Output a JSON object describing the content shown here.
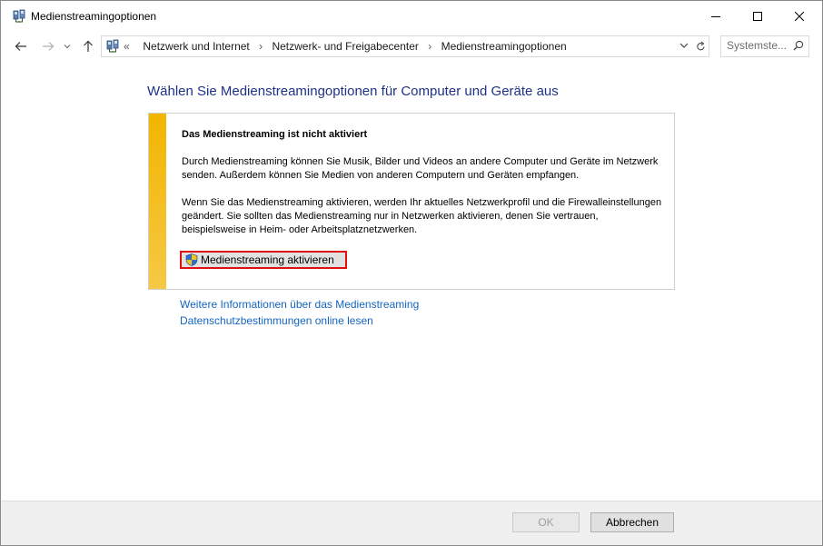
{
  "window": {
    "title": "Medienstreamingoptionen",
    "icon": "network-control-panel-icon",
    "controls": [
      "minimize-icon",
      "maximize-icon",
      "close-icon"
    ]
  },
  "address_bar": {
    "overflow": "«",
    "breadcrumbs": [
      "Netzwerk und Internet",
      "Netzwerk- und Freigabecenter",
      "Medienstreamingoptionen"
    ],
    "search_placeholder": "Systemste..."
  },
  "main": {
    "heading": "Wählen Sie Medienstreamingoptionen für Computer und Geräte aus",
    "notice": {
      "accent_color": "#f2b500",
      "title": "Das Medienstreaming ist nicht aktiviert",
      "paragraph1": "Durch Medienstreaming können Sie Musik, Bilder und Videos an andere Computer und Geräte im Netzwerk senden. Außerdem können Sie Medien von anderen Computern und Geräten empfangen.",
      "paragraph2": "Wenn Sie das Medienstreaming aktivieren, werden Ihr aktuelles Netzwerkprofil und die Firewalleinstellungen geändert. Sie sollten das Medienstreaming nur in Netzwerken aktivieren, denen Sie vertrauen, beispielsweise in Heim- oder Arbeitsplatznetzwerken.",
      "button_label": "Medienstreaming aktivieren",
      "button_highlight_color": "#e01010"
    },
    "links": [
      "Weitere Informationen über das Medienstreaming",
      "Datenschutzbestimmungen online lesen"
    ],
    "link_color": "#1565c0",
    "heading_color": "#1e3287"
  },
  "footer": {
    "ok_label": "OK",
    "cancel_label": "Abbrechen"
  }
}
